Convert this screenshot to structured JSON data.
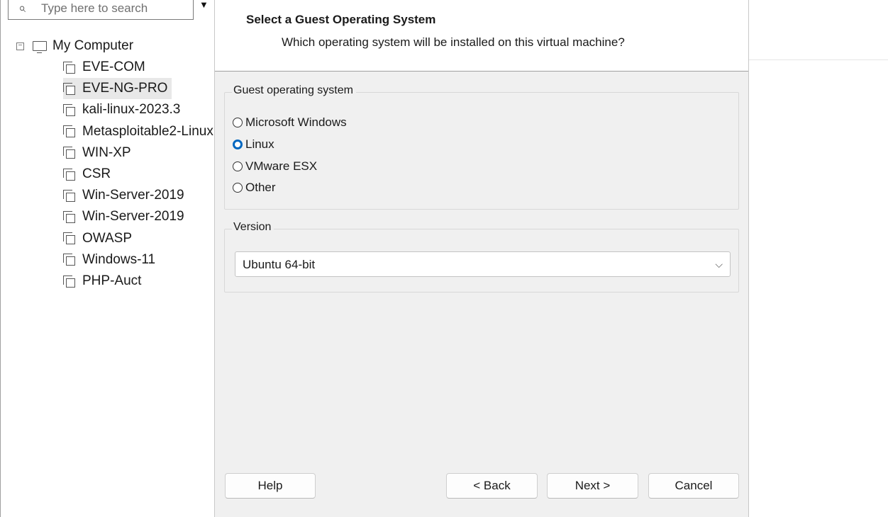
{
  "library": {
    "search_placeholder": "Type here to search",
    "root_label": "My Computer",
    "vms": [
      {
        "label": "EVE-COM"
      },
      {
        "label": "EVE-NG-PRO"
      },
      {
        "label": "kali-linux-2023.3"
      },
      {
        "label": "Metasploitable2-Linux"
      },
      {
        "label": "WIN-XP"
      },
      {
        "label": "CSR"
      },
      {
        "label": "Win-Server-2019"
      },
      {
        "label": "Win-Server-2019"
      },
      {
        "label": "OWASP"
      },
      {
        "label": "Windows-11"
      },
      {
        "label": "PHP-Auct"
      }
    ],
    "selected": "EVE-NG-PRO"
  },
  "wizard": {
    "title": "Select a Guest Operating System",
    "subtitle": "Which operating system will be installed on this virtual machine?",
    "guest_os_group": {
      "legend": "Guest operating system",
      "options": [
        {
          "label": "Microsoft Windows",
          "checked": false
        },
        {
          "label": "Linux",
          "checked": true
        },
        {
          "label": "VMware ESX",
          "checked": false
        },
        {
          "label": "Other",
          "checked": false
        }
      ]
    },
    "version_group": {
      "legend": "Version",
      "selected": "Ubuntu 64-bit"
    },
    "buttons": {
      "help": "Help",
      "back": "< Back",
      "next": "Next >",
      "cancel": "Cancel"
    }
  },
  "colors": {
    "dialog_bg": "#f0f0f0",
    "radio_accent": "#0067c0",
    "selected_item_bg": "#e8e8e8"
  }
}
